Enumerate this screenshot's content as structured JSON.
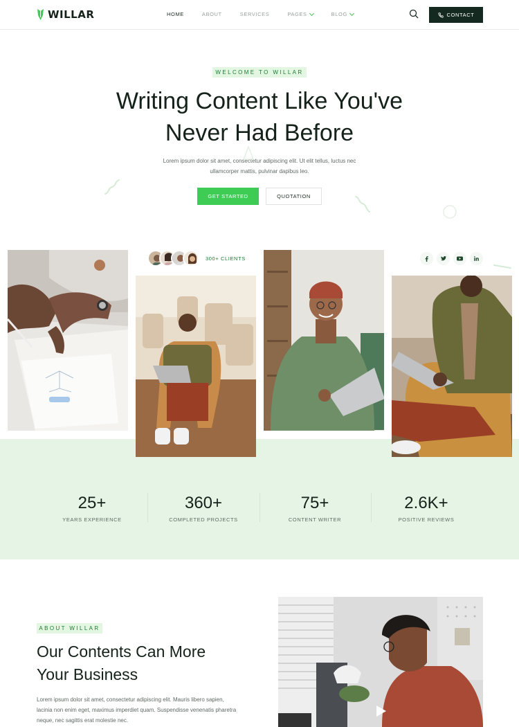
{
  "brand": {
    "name": "WILLAR",
    "accent": "#3fcc55",
    "dark": "#142a20",
    "tint": "#e5f4e4"
  },
  "nav": {
    "items": [
      {
        "label": "HOME",
        "active": true
      },
      {
        "label": "ABOUT"
      },
      {
        "label": "SERVICES"
      },
      {
        "label": "PAGES",
        "dropdown": true
      },
      {
        "label": "BLOG",
        "dropdown": true
      }
    ],
    "contact_label": "CONTACT"
  },
  "hero": {
    "tag": "WELCOME TO WILLAR",
    "title_line1": "Writing Content Like You've",
    "title_line2": "Never Had Before",
    "desc_line1": "Lorem ipsum dolor sit amet, consectetur adipiscing elit. Ut elit tellus, luctus nec",
    "desc_line2": "ullamcorper mattis, pulvinar dapibus leo.",
    "primary_button": "GET STARTED",
    "secondary_button": "QUOTATION"
  },
  "clients": {
    "label": "300+ CLIENTS"
  },
  "socials": [
    "facebook-icon",
    "twitter-icon",
    "youtube-icon",
    "linkedin-icon"
  ],
  "stats": [
    {
      "value": "25+",
      "label": "YEARS EXPERIENCE"
    },
    {
      "value": "360+",
      "label": "COMPLETED PROJECTS"
    },
    {
      "value": "75+",
      "label": "CONTENT WRITER"
    },
    {
      "value": "2.6K+",
      "label": "POSITIVE REVIEWS"
    }
  ],
  "about": {
    "tag": "ABOUT WILLAR",
    "title_line1": "Our Contents Can More",
    "title_line2": "Your Business",
    "desc_line1": "Lorem ipsum dolor sit amet, consectetur adipiscing elit. Mauris libero sapien,",
    "desc_line2": "lacinia non enim eget, maximus imperdiet quam. Suspendisse venenatis pharetra",
    "desc_line3": "neque, nec sagittis erat molestie nec."
  }
}
